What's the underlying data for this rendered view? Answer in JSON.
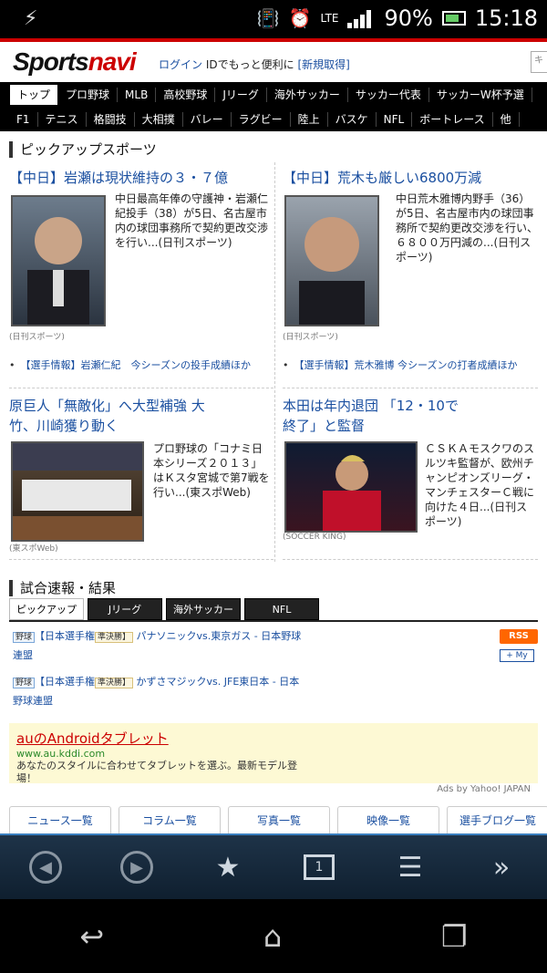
{
  "status": {
    "lte": "LTE",
    "battery": "90%",
    "time": "15:18"
  },
  "header": {
    "logo_a": "Sports",
    "logo_b": "navi",
    "login": "ログイン",
    "login_text": "IDでもっと便利に",
    "register": "[新規取得]"
  },
  "nav1": [
    "トップ",
    "プロ野球",
    "MLB",
    "高校野球",
    "Jリーグ",
    "海外サッカー",
    "サッカー代表",
    "サッカーW杯予選"
  ],
  "nav2": [
    "F1",
    "テニス",
    "格闘技",
    "大相撲",
    "バレー",
    "ラグビー",
    "陸上",
    "バスケ",
    "NFL",
    "ボートレース",
    "他"
  ],
  "pickup": {
    "title": "ピックアップスポーツ",
    "items": [
      {
        "headline": "【中日】岩瀬は現状維持の３・７億",
        "text": "中日最高年俸の守護神・岩瀬仁紀投手（38）が5日、名古屋市内の球団事務所で契約更改交渉を行い...(日刊スポーツ)",
        "caption": "(日刊スポーツ)",
        "related": "【選手情報】岩瀬仁紀　今シーズンの投手成績ほか"
      },
      {
        "headline": "【中日】荒木も厳しい6800万減",
        "text": "中日荒木雅博内野手（36）が5日、名古屋市内の球団事務所で契約更改交渉を行い、６８００万円減の...(日刊スポーツ)",
        "caption": "(日刊スポーツ)",
        "related": "【選手情報】荒木雅博 今シーズンの打者成績ほか"
      },
      {
        "headline": "原巨人「無敵化」へ大型補強 大竹、川崎獲り動く",
        "text": "プロ野球の「コナミ日本シリーズ２０１３」はＫスタ宮城で第7戦を行い...(東スポWeb)",
        "caption": "(東スポWeb)"
      },
      {
        "headline": "本田は年内退団 「12・10で終了」と監督",
        "text": "ＣＳＫＡモスクワのスルツキ監督が、欧州チャンピオンズリーグ・マンチェスターＣ戦に向けた４日...(日刊スポーツ)",
        "caption": "(SOCCER KING)"
      }
    ]
  },
  "results": {
    "title": "試合速報・結果",
    "tabs": [
      "ピックアップ",
      "Jリーグ",
      "海外サッカー",
      "NFL"
    ],
    "rss": "RSS",
    "myyahoo": "+ My",
    "games": [
      {
        "tag": "野球",
        "cat": "【日本選手権",
        "status": "準決勝】",
        "match": "パナソニックvs.東京ガス - 日本野球連盟"
      },
      {
        "tag": "野球",
        "cat": "【日本選手権",
        "status": "準決勝】",
        "match": "かずさマジックvs. JFE東日本 - 日本野球連盟"
      }
    ]
  },
  "ad": {
    "title": "auのAndroidタブレット",
    "url": "www.au.kddi.com",
    "desc": "あなたのスタイルに合わせてタブレットを選ぶ。最新モデル登場！",
    "by": "Ads by Yahoo! JAPAN"
  },
  "links": [
    "ニュース一覧",
    "コラム一覧",
    "写真一覧",
    "映像一覧",
    "選手ブログ一覧"
  ],
  "toolbar": {
    "tab_count": "1"
  }
}
